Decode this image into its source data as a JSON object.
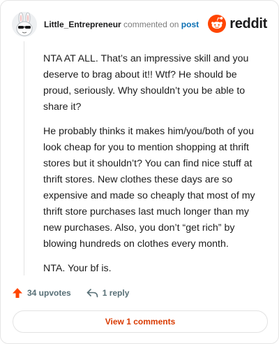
{
  "comment": {
    "username": "Little_Entrepreneur",
    "action_text": "commented on",
    "target_link": "post",
    "brand": "reddit",
    "paragraphs": [
      "NTA AT ALL. That’s an impressive skill and you deserve to brag about it!! Wtf? He should be proud, seriously. Why shouldn’t you be able to share it?",
      "He probably thinks it makes him/you/both of you look cheap for you to mention shopping at thrift stores but it shouldn’t? You can find nice stuff at thrift stores. New clothes these days are so expensive and made so cheaply that most of my thrift store purchases last much longer than my new purchases. Also, you don’t “get rich” by blowing hundreds on clothes every month.",
      "NTA. Your bf is."
    ]
  },
  "actions": {
    "upvotes": "34 upvotes",
    "replies": "1 reply",
    "view_comments": "View 1 comments"
  },
  "colors": {
    "accent": "#d93a00",
    "brand_orange": "#ff4500",
    "link": "#0a6fb3",
    "muted": "#576f76"
  },
  "icons": {
    "avatar": "bunny-sunglasses-avatar",
    "brand": "reddit-alien-icon",
    "upvote": "upvote-arrow-icon",
    "reply": "reply-arrow-icon"
  }
}
